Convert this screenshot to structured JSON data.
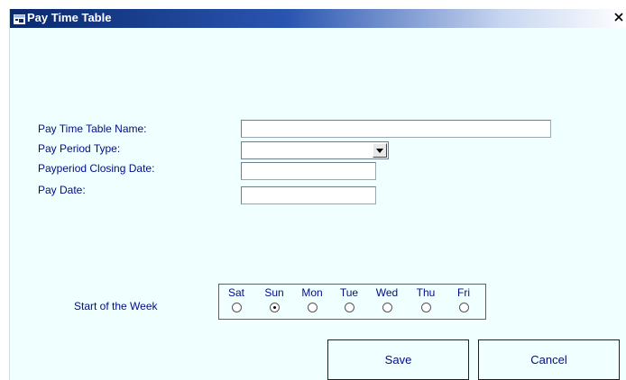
{
  "window": {
    "title": "Pay Time Table",
    "close_glyph": "✕"
  },
  "form": {
    "name_label": "Pay Time Table Name:",
    "name_value": "",
    "period_type_label": "Pay Period Type:",
    "period_type_value": "",
    "closing_date_label": "Payperiod Closing Date:",
    "closing_date_value": "",
    "pay_date_label": "Pay Date:",
    "pay_date_value": ""
  },
  "week": {
    "label": "Start of the Week",
    "days": [
      "Sat",
      "Sun",
      "Mon",
      "Tue",
      "Wed",
      "Thu",
      "Fri"
    ],
    "selected": "Sun"
  },
  "buttons": {
    "save": "Save",
    "cancel": "Cancel"
  },
  "icons": {
    "window": "window-icon",
    "close": "close-icon",
    "dropdown": "chevron-down-icon"
  },
  "colors": {
    "background": "#f0ffff",
    "label": "#000c8a",
    "titlebar_start": "#0a2a6e"
  }
}
